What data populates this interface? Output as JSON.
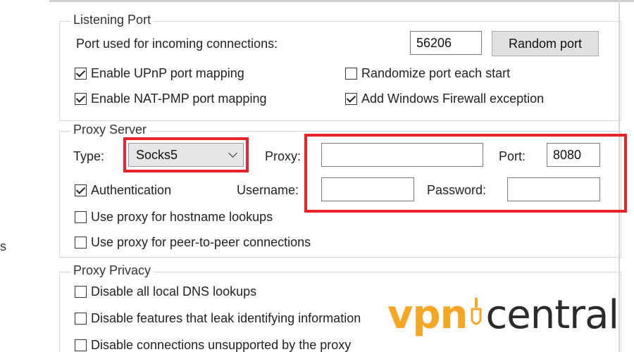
{
  "left_fragment": "s",
  "listening_port": {
    "title": "Listening Port",
    "port_label": "Port used for incoming connections:",
    "port_value": "56206",
    "random_port_label": "Random port",
    "checkboxes": [
      {
        "label": "Enable UPnP port mapping",
        "checked": true
      },
      {
        "label": "Enable NAT-PMP port mapping",
        "checked": true
      },
      {
        "label": "Randomize port each start",
        "checked": false
      },
      {
        "label": "Add Windows Firewall exception",
        "checked": true
      }
    ]
  },
  "proxy_server": {
    "title": "Proxy Server",
    "type_label": "Type:",
    "type_value": "Socks5",
    "proxy_label": "Proxy:",
    "proxy_value": "",
    "port_label": "Port:",
    "port_value": "8080",
    "authentication_label": "Authentication",
    "authentication_checked": true,
    "username_label": "Username:",
    "username_value": "",
    "password_label": "Password:",
    "password_value": "",
    "hostname_lookups_label": "Use proxy for hostname lookups",
    "hostname_lookups_checked": false,
    "p2p_label": "Use proxy for peer-to-peer connections",
    "p2p_checked": false
  },
  "proxy_privacy": {
    "title": "Proxy Privacy",
    "checkboxes": [
      {
        "label": "Disable all local DNS lookups",
        "checked": false
      },
      {
        "label": "Disable features that leak identifying information",
        "checked": false
      },
      {
        "label": "Disable connections unsupported by the proxy",
        "checked": false
      }
    ]
  },
  "watermark": {
    "part_a": "vpn",
    "part_b": "central"
  },
  "colors": {
    "highlight": "#e8232a",
    "watermark_accent": "#f5a623",
    "watermark_dark": "#2b2b2b"
  }
}
